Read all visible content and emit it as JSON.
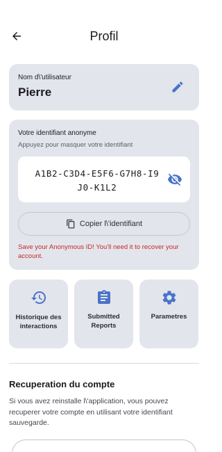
{
  "header": {
    "title": "Profil",
    "back_icon": "arrow-back-icon"
  },
  "username_card": {
    "label": "Nom d\\'utilisateur",
    "value": "Pierre",
    "edit_icon": "pencil-icon"
  },
  "anonymous_id": {
    "title": "Votre identifiant anonyme",
    "subtitle": "Appuyez pour masquer votre identifiant",
    "value_line1": "A1B2-C3D4-E5F6-G7H8-I9",
    "value_line2": "J0-K1L2",
    "toggle_icon": "eye-off-icon",
    "copy_label": "Copier l\\'identifiant",
    "copy_icon": "copy-icon",
    "warning": "Save your Anonymous ID! You'll need it to recover your account."
  },
  "tiles": [
    {
      "label": "Historique des interactions",
      "icon": "history-icon"
    },
    {
      "label": "Submitted Reports",
      "icon": "clipboard-icon"
    },
    {
      "label": "Parametres",
      "icon": "gear-icon"
    }
  ],
  "recovery": {
    "title": "Recuperation du compte",
    "body": "Si vous avez reinstalle l\\'application, vous pouvez recuperer votre compte en utilisant votre identifiant sauvegarde."
  },
  "colors": {
    "accent": "#4a73c9",
    "card_bg": "#e3e5ec",
    "warning": "#c62828"
  }
}
